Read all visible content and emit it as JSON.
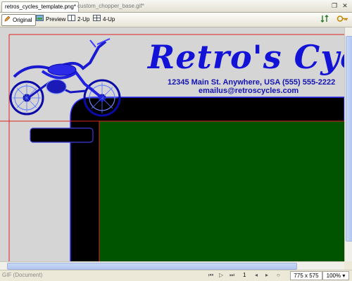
{
  "tabs": [
    {
      "label": "retros_cycles_template.png*",
      "active": true
    },
    {
      "label": "custom_chopper_base.gif*",
      "active": false
    }
  ],
  "window_controls": {
    "restore_icon": "restore-icon",
    "close_icon": "close-icon"
  },
  "toolbar": {
    "original_label": "Original",
    "preview_label": "Preview",
    "twoup_label": "2-Up",
    "fourup_label": "4-Up"
  },
  "canvas": {
    "title": "Retro's Cycles",
    "address": "12345 Main St. Anywhere, USA (555) 555-2222",
    "email": "emailus@retroscycles.com",
    "colors": {
      "background": "#d5d5d5",
      "dark": "#000000",
      "content": "#005400",
      "accent": "#1313d8",
      "guide": "#dd2222"
    }
  },
  "status": {
    "doc_type": "GIF (Document)",
    "frame": "1",
    "dimensions": "775 x 575",
    "zoom": "100%"
  }
}
